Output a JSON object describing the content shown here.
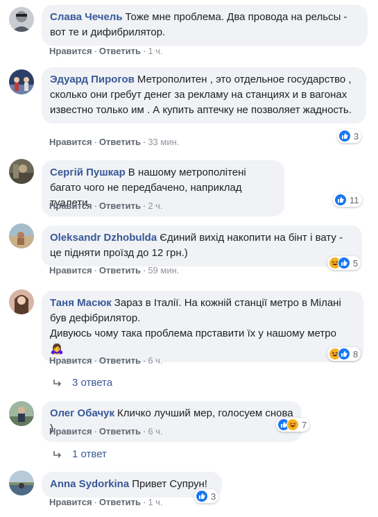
{
  "ui": {
    "like": "Нравится",
    "reply": "Ответить",
    "dot": "·"
  },
  "comments": [
    {
      "author": "Слава Чечель",
      "text": "Тоже мне проблема. Два провода на рельсы - вот те и дифибрилятор.",
      "time": "1 ч.",
      "reactions": [],
      "count": ""
    },
    {
      "author": "Эдуард Пирогов",
      "text": "Метрополитен , это отдельное государство , сколько они гребут денег за рекламу на станциях и в вагонах известно только им . А купить аптечку не позволяет жадность.",
      "time": "33 мин.",
      "reactions": [
        "like"
      ],
      "count": "3"
    },
    {
      "author": "Сергій Пушкар",
      "text": "В нашому метрополітені багато чого не передбачено, наприклад туалети",
      "time": "2 ч.",
      "reactions": [
        "like"
      ],
      "count": "11"
    },
    {
      "author": "Oleksandr Dzhobulda",
      "text": "Єдиний вихід накопити на бінт і вату - це підняти проїзд до 12 грн.)",
      "time": "59 мин.",
      "reactions": [
        "haha",
        "like"
      ],
      "count": "5"
    },
    {
      "author": "Таня Масюк",
      "text": "Зараз в Італії. На кожній станції метро в Мілані був дефібрилятор.",
      "text2": "Дивуюсь чому така проблема прставити їх у нашому метро",
      "emoji": "🙇‍♀️",
      "time": "6 ч.",
      "reactions": [
        "haha",
        "like"
      ],
      "count": "8"
    },
    {
      "author": "Олег Обачук",
      "text": "Кличко лучший мер, голосуем снова )",
      "time": "6 ч.",
      "reactions": [
        "like",
        "haha"
      ],
      "count": "7"
    },
    {
      "author": "Anna Sydorkina",
      "text": "Привет Супрун!",
      "time": "1 ч.",
      "reactions": [
        "like"
      ],
      "count": "3"
    }
  ],
  "replies": [
    {
      "label": "3 ответа"
    },
    {
      "label": "1 ответ"
    }
  ],
  "colors": {
    "author": "#385898",
    "bubble": "#f0f2f5",
    "like": "#1877f2",
    "haha": "#f7b125"
  }
}
